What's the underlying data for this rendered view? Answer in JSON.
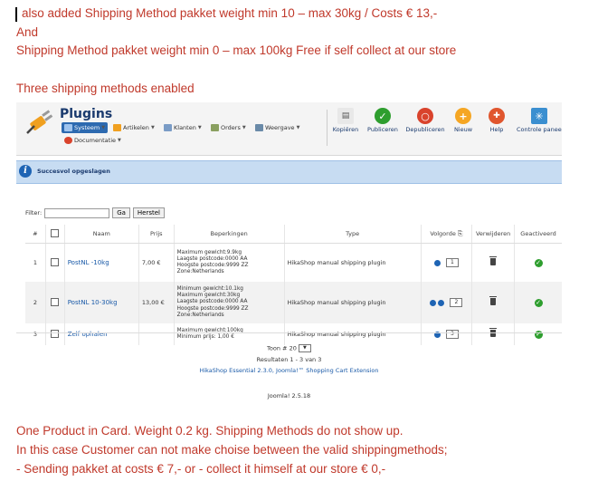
{
  "notes_top": [
    "also added Shipping Method pakket weight  min 10 – max 30kg  / Costs  €  13,-",
    "And",
    "Shipping Method pakket weight  min 0 – max 100kg      Free if self collect at our store",
    "Three shipping methods enabled"
  ],
  "notes_bottom": [
    "One Product in  Card. Weight 0.2 kg.  Shipping Methods do not show up.",
    "In this case Customer can not make choise between  the valid  shippingmethods;",
    "- Sending pakket at costs € 7,-    or     - collect  it himself at  our store  € 0,-"
  ],
  "app": {
    "title": "Plugins",
    "menus": [
      {
        "label": "Systeem",
        "icon": "system-icon"
      },
      {
        "label": "Artikelen",
        "icon": "products-icon"
      },
      {
        "label": "Klanten",
        "icon": "customers-icon"
      },
      {
        "label": "Orders",
        "icon": "orders-icon"
      },
      {
        "label": "Weergave",
        "icon": "display-icon"
      },
      {
        "label": "Documentatie",
        "icon": "documentation-icon"
      }
    ],
    "toolbar": [
      "Kopiëren",
      "Publiceren",
      "Depubliceren",
      "Nieuw",
      "Help",
      "Controle paneel"
    ],
    "message": "Succesvol opgeslagen",
    "filter": {
      "label": "Filter:",
      "value": "",
      "go": "Ga",
      "reset": "Herstel"
    },
    "columns": [
      "#",
      "",
      "Naam",
      "Prijs",
      "Beperkingen",
      "Type",
      "Volgorde",
      "Verwijderen",
      "Geactiveerd"
    ],
    "rows": [
      {
        "num": "1",
        "name": "PostNL -10kg",
        "price": "7,00 €",
        "conditions": [
          "Maximum gewicht:9.9kg",
          "Laagste postcode:0000 AA",
          "Hoogste postcode:9999 ZZ",
          "Zone:Netherlands"
        ],
        "type": "HikaShop manual shipping plugin",
        "order": "1",
        "arrows": 1
      },
      {
        "num": "2",
        "name": "PostNL 10-30kg",
        "price": "13,00 €",
        "conditions": [
          "Minimum gewicht:10.1kg",
          "Maximum gewicht:30kg",
          "Laagste postcode:0000 AA",
          "Hoogste postcode:9999 ZZ",
          "Zone:Netherlands"
        ],
        "type": "HikaShop manual shipping plugin",
        "order": "2",
        "arrows": 2
      },
      {
        "num": "3",
        "name": "Zelf ophalen",
        "price": "",
        "conditions": [
          "Maximum gewicht:100kg",
          "Minimum prijs: 1,00 €"
        ],
        "type": "HikaShop manual shipping plugin",
        "order": "3",
        "arrows": 1
      }
    ],
    "display_label": "Toon #",
    "display_value": "20",
    "results": "Resultaten 1 - 3 van 3",
    "extension": "HikaShop Essential 2.3.0, Joomla!™ Shopping Cart Extension",
    "version": "Joomla! 2.5.18"
  },
  "colors": {
    "note_text": "#c0392b",
    "accent": "#1e64b4",
    "publish": "#2e9e2e",
    "unpublish": "#d9432c",
    "new": "#f5a623"
  }
}
